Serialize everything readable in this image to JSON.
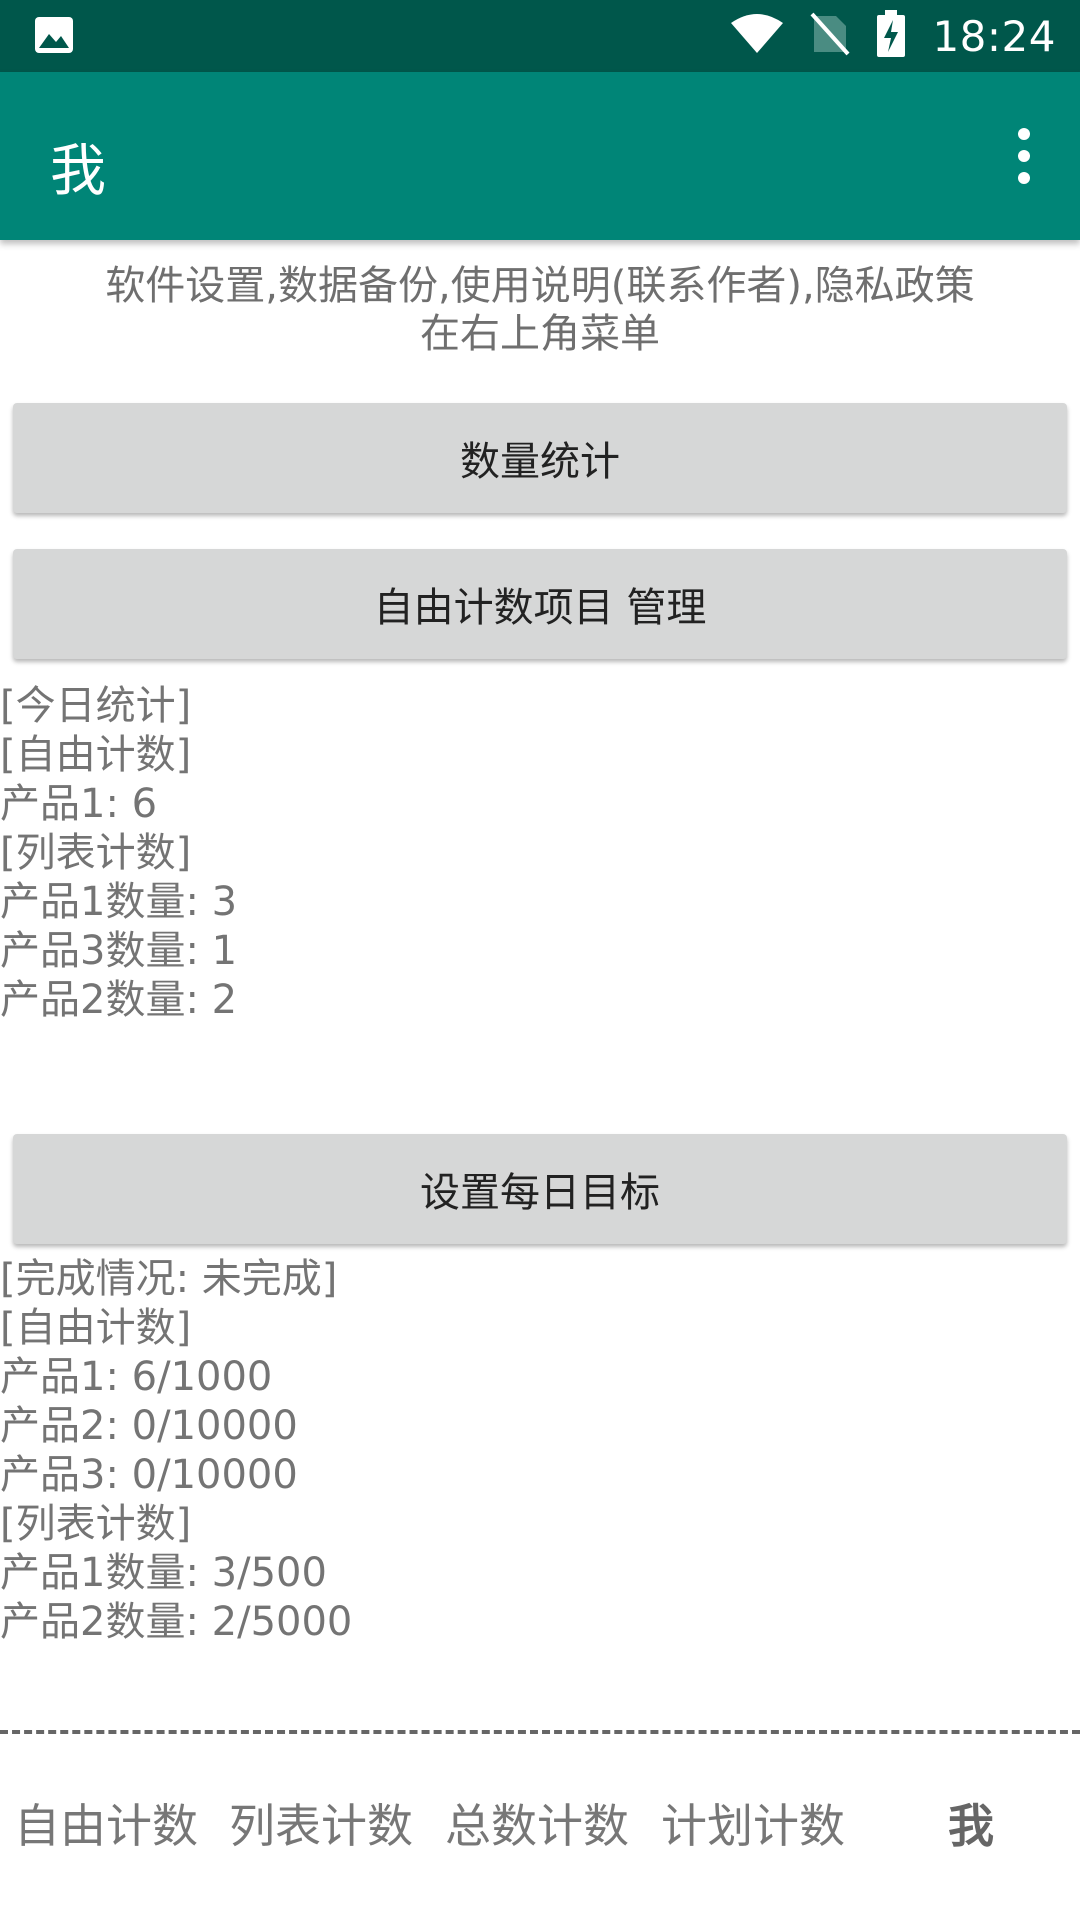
{
  "status_bar": {
    "time": "18:24",
    "icons": [
      "image-icon",
      "wifi-icon",
      "no-sim-icon",
      "battery-charging-icon"
    ]
  },
  "app_bar": {
    "title": "我"
  },
  "hint": {
    "line1": "软件设置,数据备份,使用说明(联系作者),隐私政策",
    "line2": "在右上角菜单"
  },
  "buttons": {
    "stats": "数量统计",
    "manage": "自由计数项目 管理",
    "daily_goal": "设置每日目标"
  },
  "today_stats": [
    "[今日统计]",
    "[自由计数]",
    "产品1: 6",
    "[列表计数]",
    "产品1数量: 3",
    "产品3数量: 1",
    "产品2数量: 2"
  ],
  "completion": [
    "[完成情况: 未完成]",
    "[自由计数]",
    "产品1: 6/1000",
    "产品2: 0/10000",
    "产品3: 0/10000",
    "[列表计数]",
    "产品1数量: 3/500",
    "产品2数量: 2/5000"
  ],
  "bottom_nav": {
    "items": [
      "自由计数",
      "列表计数",
      "总数计数",
      "计划计数",
      "我"
    ],
    "active": "我"
  },
  "colors": {
    "status_bar": "#00574b",
    "app_bar": "#008577",
    "button": "#d6d7d7"
  }
}
